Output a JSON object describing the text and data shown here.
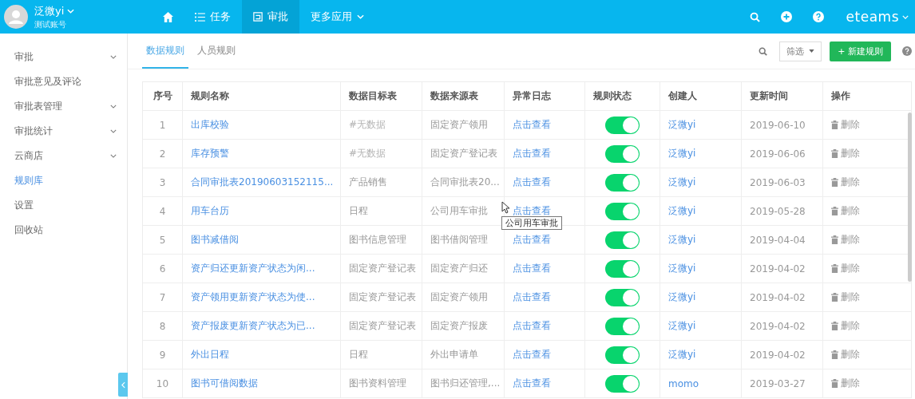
{
  "user": {
    "name": "泛微yi",
    "account": "测试账号"
  },
  "nav": [
    {
      "kind": "home",
      "selected": false
    },
    {
      "kind": "list",
      "label": "任务",
      "selected": false
    },
    {
      "kind": "approve",
      "label": "审批",
      "selected": true
    },
    {
      "kind": "more",
      "label": "更多应用",
      "selected": false
    }
  ],
  "brand": "eteams",
  "sidebar": {
    "items": [
      {
        "label": "审批",
        "expandable": true,
        "selected": false
      },
      {
        "label": "审批意见及评论",
        "expandable": false,
        "selected": false
      },
      {
        "label": "审批表管理",
        "expandable": true,
        "selected": false
      },
      {
        "label": "审批统计",
        "expandable": true,
        "selected": false
      },
      {
        "label": "云商店",
        "expandable": true,
        "selected": false
      },
      {
        "label": "规则库",
        "expandable": false,
        "selected": true
      },
      {
        "label": "设置",
        "expandable": false,
        "selected": false
      },
      {
        "label": "回收站",
        "expandable": false,
        "selected": false
      }
    ]
  },
  "tabs": [
    {
      "label": "数据规则",
      "selected": true
    },
    {
      "label": "人员规则",
      "selected": false
    }
  ],
  "filter_button": "筛选",
  "new_button": "+ 新建规则",
  "table": {
    "columns": [
      "序号",
      "规则名称",
      "数据目标表",
      "数据来源表",
      "异常日志",
      "规则状态",
      "创建人",
      "更新时间",
      "操作"
    ],
    "rows": [
      {
        "no": "1",
        "name": "出库校验",
        "target": "#无数据",
        "target_empty": true,
        "source": "固定资产领用",
        "log": "点击查看",
        "on": true,
        "creator": "泛微yi",
        "updated": "2019-06-10",
        "action": "删除"
      },
      {
        "no": "2",
        "name": "库存预警",
        "target": "#无数据",
        "target_empty": true,
        "source": "固定资产登记表",
        "log": "点击查看",
        "on": true,
        "creator": "泛微yi",
        "updated": "2019-06-06",
        "action": "删除"
      },
      {
        "no": "3",
        "name": "合同审批表20190603152115...",
        "target": "产品销售",
        "target_empty": false,
        "source": "合同审批表20...",
        "log": "点击查看",
        "on": true,
        "creator": "泛微yi",
        "updated": "2019-06-03",
        "action": "删除"
      },
      {
        "no": "4",
        "name": "用车台历",
        "target": "日程",
        "target_empty": false,
        "source": "公司用车审批",
        "log": "点击查看",
        "on": true,
        "creator": "泛微yi",
        "updated": "2019-05-28",
        "action": "删除"
      },
      {
        "no": "5",
        "name": "图书减借阅",
        "target": "图书信息管理",
        "target_empty": false,
        "source": "图书借阅管理",
        "log": "点击查看",
        "on": true,
        "creator": "泛微yi",
        "updated": "2019-04-04",
        "action": "删除"
      },
      {
        "no": "6",
        "name": "资产归还更新资产状态为闲...",
        "target": "固定资产登记表",
        "target_empty": false,
        "source": "固定资产归还",
        "log": "点击查看",
        "on": true,
        "creator": "泛微yi",
        "updated": "2019-04-02",
        "action": "删除"
      },
      {
        "no": "7",
        "name": "资产领用更新资产状态为使...",
        "target": "固定资产登记表",
        "target_empty": false,
        "source": "固定资产领用",
        "log": "点击查看",
        "on": true,
        "creator": "泛微yi",
        "updated": "2019-04-02",
        "action": "删除"
      },
      {
        "no": "8",
        "name": "资产报废更新资产状态为已...",
        "target": "固定资产登记表",
        "target_empty": false,
        "source": "固定资产报废",
        "log": "点击查看",
        "on": true,
        "creator": "泛微yi",
        "updated": "2019-04-02",
        "action": "删除"
      },
      {
        "no": "9",
        "name": "外出日程",
        "target": "日程",
        "target_empty": false,
        "source": "外出申请单",
        "log": "点击查看",
        "on": true,
        "creator": "泛微yi",
        "updated": "2019-04-02",
        "action": "删除"
      },
      {
        "no": "10",
        "name": "图书可借阅数据",
        "target": "图书资料管理",
        "target_empty": false,
        "source": "图书归还管理,...",
        "log": "点击查看",
        "on": true,
        "creator": "momo",
        "updated": "2019-03-27",
        "action": "删除"
      }
    ]
  },
  "tooltip": "公司用车审批"
}
